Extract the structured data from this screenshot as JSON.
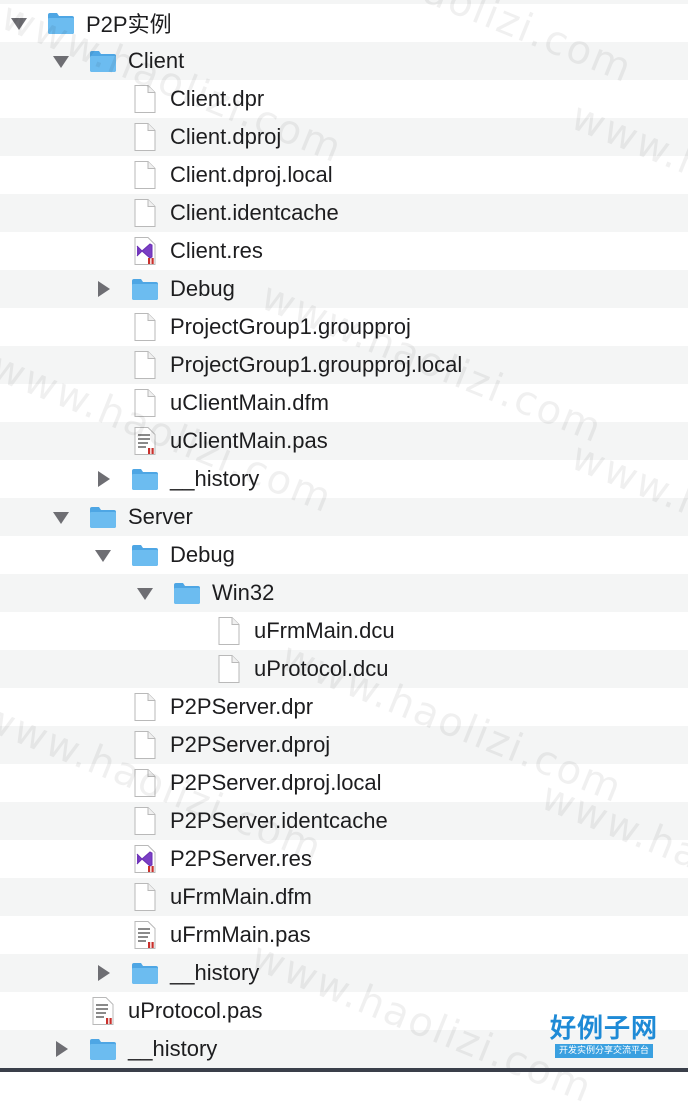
{
  "tree": {
    "rows": [
      {
        "label": "P2P实例",
        "icon": "folder-icon",
        "disclosure": "expanded",
        "level": 0
      },
      {
        "label": "Client",
        "icon": "folder-icon",
        "disclosure": "expanded",
        "level": 1
      },
      {
        "label": "Client.dpr",
        "icon": "document-icon",
        "disclosure": "none",
        "level": 2
      },
      {
        "label": "Client.dproj",
        "icon": "document-icon",
        "disclosure": "none",
        "level": 2
      },
      {
        "label": "Client.dproj.local",
        "icon": "document-icon",
        "disclosure": "none",
        "level": 2
      },
      {
        "label": "Client.identcache",
        "icon": "document-icon",
        "disclosure": "none",
        "level": 2
      },
      {
        "label": "Client.res",
        "icon": "visual-studio-file-icon",
        "disclosure": "none",
        "level": 2
      },
      {
        "label": "Debug",
        "icon": "folder-icon",
        "disclosure": "collapsed",
        "level": 2
      },
      {
        "label": "ProjectGroup1.groupproj",
        "icon": "document-icon",
        "disclosure": "none",
        "level": 2
      },
      {
        "label": "ProjectGroup1.groupproj.local",
        "icon": "document-icon",
        "disclosure": "none",
        "level": 2
      },
      {
        "label": "uClientMain.dfm",
        "icon": "document-icon",
        "disclosure": "none",
        "level": 2
      },
      {
        "label": "uClientMain.pas",
        "icon": "source-file-icon",
        "disclosure": "none",
        "level": 2
      },
      {
        "label": "__history",
        "icon": "folder-icon",
        "disclosure": "collapsed",
        "level": 2
      },
      {
        "label": "Server",
        "icon": "folder-icon",
        "disclosure": "expanded",
        "level": 1
      },
      {
        "label": "Debug",
        "icon": "folder-icon",
        "disclosure": "expanded",
        "level": 2
      },
      {
        "label": "Win32",
        "icon": "folder-icon",
        "disclosure": "expanded",
        "level": 3
      },
      {
        "label": "uFrmMain.dcu",
        "icon": "document-icon",
        "disclosure": "none",
        "level": 4
      },
      {
        "label": "uProtocol.dcu",
        "icon": "document-icon",
        "disclosure": "none",
        "level": 4
      },
      {
        "label": "P2PServer.dpr",
        "icon": "document-icon",
        "disclosure": "none",
        "level": 2
      },
      {
        "label": "P2PServer.dproj",
        "icon": "document-icon",
        "disclosure": "none",
        "level": 2
      },
      {
        "label": "P2PServer.dproj.local",
        "icon": "document-icon",
        "disclosure": "none",
        "level": 2
      },
      {
        "label": "P2PServer.identcache",
        "icon": "document-icon",
        "disclosure": "none",
        "level": 2
      },
      {
        "label": "P2PServer.res",
        "icon": "visual-studio-file-icon",
        "disclosure": "none",
        "level": 2
      },
      {
        "label": "uFrmMain.dfm",
        "icon": "document-icon",
        "disclosure": "none",
        "level": 2
      },
      {
        "label": "uFrmMain.pas",
        "icon": "source-file-icon",
        "disclosure": "none",
        "level": 2
      },
      {
        "label": "__history",
        "icon": "folder-icon",
        "disclosure": "collapsed",
        "level": 2
      },
      {
        "label": "uProtocol.pas",
        "icon": "source-file-icon",
        "disclosure": "none",
        "level": 1
      },
      {
        "label": "__history",
        "icon": "folder-icon",
        "disclosure": "collapsed",
        "level": 1
      }
    ]
  },
  "watermark": {
    "text": "www.haolizi.com"
  },
  "logo": {
    "main": "好例子网",
    "sub": "开发实例分享交流平台"
  },
  "colors": {
    "folder": "#6cbcf0",
    "folder_dark": "#4ea6e4",
    "stripe": "#f4f5f5",
    "text": "#1d1d1f",
    "vs_purple": "#7a3fc4",
    "red_mark": "#c9302c"
  }
}
